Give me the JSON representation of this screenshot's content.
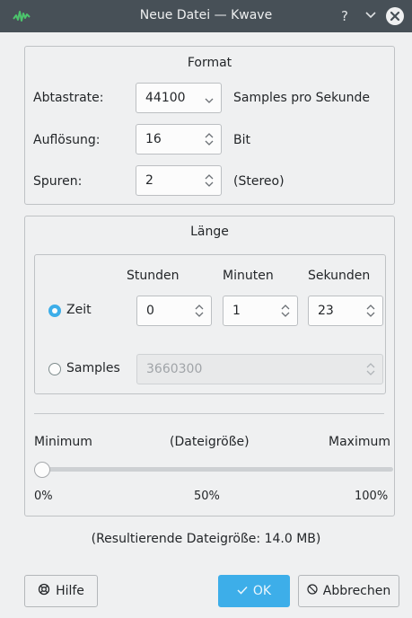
{
  "window": {
    "title": "Neue Datei — Kwave",
    "help_glyph": "?",
    "minimize_glyph": "⌄",
    "close_glyph": "✕"
  },
  "format": {
    "title": "Format",
    "rate_label": "Abtastrate:",
    "rate_value": "44100",
    "rate_unit": "Samples pro Sekunde",
    "resolution_label": "Auflösung:",
    "resolution_value": "16",
    "resolution_unit": "Bit",
    "tracks_label": "Spuren:",
    "tracks_value": "2",
    "tracks_unit": "(Stereo)"
  },
  "length": {
    "title": "Länge",
    "hours_header": "Stunden",
    "minutes_header": "Minuten",
    "seconds_header": "Sekunden",
    "time_label": "Zeit",
    "time_selected": true,
    "hours_value": "0",
    "minutes_value": "1",
    "seconds_value": "23",
    "samples_label": "Samples",
    "samples_value": "3660300",
    "size_min_label": "Minimum",
    "size_mid_label": "(Dateigröße)",
    "size_max_label": "Maximum",
    "slider_fraction": 0.0,
    "tick_0": "0%",
    "tick_50": "50%",
    "tick_100": "100%"
  },
  "result_text": "(Resultierende Dateigröße: 14.0 MB)",
  "buttons": {
    "help": "Hilfe",
    "ok": "OK",
    "cancel": "Abbrechen"
  },
  "colors": {
    "accent": "#3daee9",
    "titlebar": "#475057",
    "background": "#eff0f1"
  }
}
